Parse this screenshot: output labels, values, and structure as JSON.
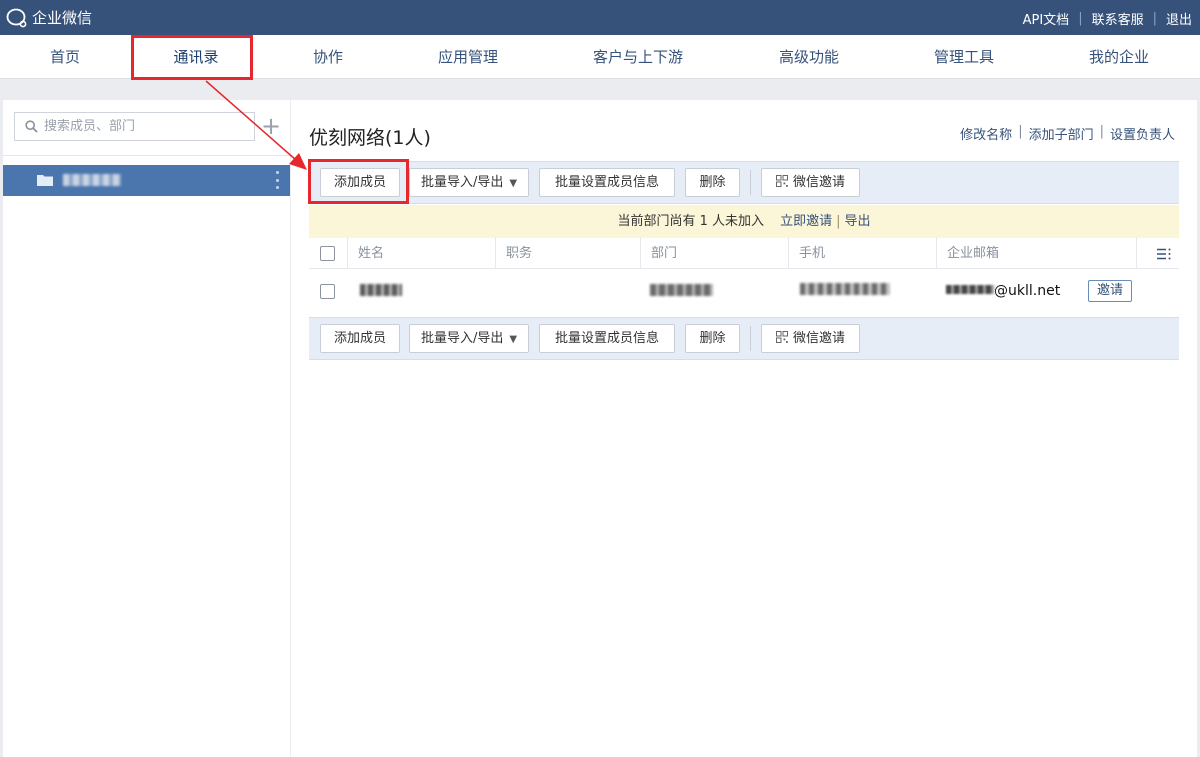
{
  "app": {
    "logo_text": "企业微信"
  },
  "top_links": [
    "API文档",
    "联系客服",
    "退出"
  ],
  "nav": {
    "items": [
      {
        "label": "首页"
      },
      {
        "label": "通讯录"
      },
      {
        "label": "协作"
      },
      {
        "label": "应用管理"
      },
      {
        "label": "客户与上下游"
      },
      {
        "label": "高级功能"
      },
      {
        "label": "管理工具"
      },
      {
        "label": "我的企业"
      }
    ],
    "active": "通讯录"
  },
  "sidebar": {
    "search_placeholder": "搜索成员、部门",
    "add_icon": "plus-icon"
  },
  "main": {
    "title": "优刻网络(1人)",
    "actions": [
      "修改名称",
      "添加子部门",
      "设置负责人"
    ],
    "toolbar": {
      "add_member": "添加成员",
      "batch_import_export": "批量导入/导出",
      "batch_set_info": "批量设置成员信息",
      "delete": "删除",
      "wechat_invite": "微信邀请"
    },
    "notice": {
      "text": "当前部门尚有 1 人未加入",
      "invite_now": "立即邀请",
      "export": "导出"
    },
    "table": {
      "headers": [
        "姓名",
        "职务",
        "部门",
        "手机",
        "企业邮箱"
      ],
      "rows": [
        {
          "email_domain": "@ukll.net",
          "action": "邀请"
        }
      ]
    }
  },
  "colors": {
    "topbar": "#36527a",
    "selected_dept": "#4b75ad",
    "highlight": "#e4282d",
    "notice_bg": "#fcf6d9"
  }
}
